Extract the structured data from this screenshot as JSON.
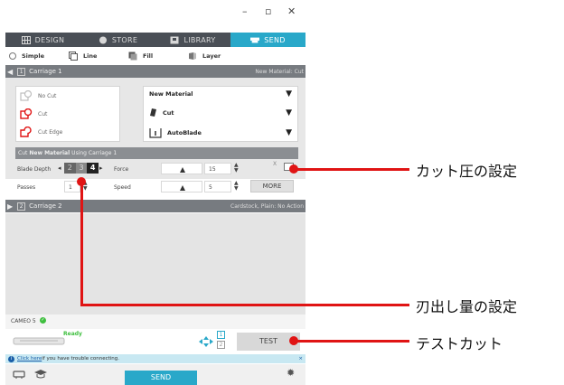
{
  "window": {
    "minimize": "–",
    "restore": "▫",
    "close": "✕"
  },
  "tabs": [
    {
      "label": "DESIGN",
      "icon": "grid-icon",
      "active": false
    },
    {
      "label": "STORE",
      "icon": "store-icon",
      "active": false
    },
    {
      "label": "LIBRARY",
      "icon": "library-icon",
      "active": false
    },
    {
      "label": "SEND",
      "icon": "cutter-icon",
      "active": true
    }
  ],
  "modes": [
    {
      "label": "Simple",
      "icon": "radio-icon"
    },
    {
      "label": "Line",
      "icon": "line-icon"
    },
    {
      "label": "Fill",
      "icon": "fill-icon"
    },
    {
      "label": "Layer",
      "icon": "layer-icon"
    }
  ],
  "carriage1": {
    "num": "1",
    "label": "Carriage 1",
    "material": "New Material: Cut"
  },
  "cut_options": [
    {
      "label": "No Cut",
      "color": "#bdbdbd"
    },
    {
      "label": "Cut",
      "color": "#e01414"
    },
    {
      "label": "Cut Edge",
      "color": "#e01414"
    }
  ],
  "material_rows": [
    {
      "label": "New Material",
      "icon": "",
      "arrow": "▼"
    },
    {
      "label": "Cut",
      "icon": "blade-icon",
      "arrow": "▼"
    },
    {
      "label": "AutoBlade",
      "icon": "autoblade-icon",
      "arrow": "▼"
    }
  ],
  "subhead": {
    "prefix": "Cut ",
    "material": "New Material",
    "suffix": " Using Carriage 1"
  },
  "settings": {
    "blade_depth_label": "Blade Depth",
    "blade_depth_values": [
      "2",
      "3",
      "4"
    ],
    "passes_label": "Passes",
    "passes_value": "1",
    "force_label": "Force",
    "force_value": "15",
    "speed_label": "Speed",
    "speed_value": "5",
    "more_label": "MORE",
    "x_label": "X"
  },
  "carriage2": {
    "num": "2",
    "label": "Carriage 2",
    "material": "Cardstock, Plain: No Action"
  },
  "device": {
    "name": "CAMEO 5",
    "status": "Ready",
    "test_label": "TEST",
    "ports": [
      "1",
      "2"
    ]
  },
  "info": {
    "link": "Click here",
    "text": " if you have trouble connecting.",
    "close": "×"
  },
  "bottom": {
    "send_label": "SEND"
  },
  "annotations": {
    "force": "カット圧の設定",
    "blade": "刃出し量の設定",
    "test": "テストカット"
  },
  "colors": {
    "accent": "#29a8c9",
    "annotation_red": "#e01414",
    "tabbar": "#4a4f56"
  }
}
